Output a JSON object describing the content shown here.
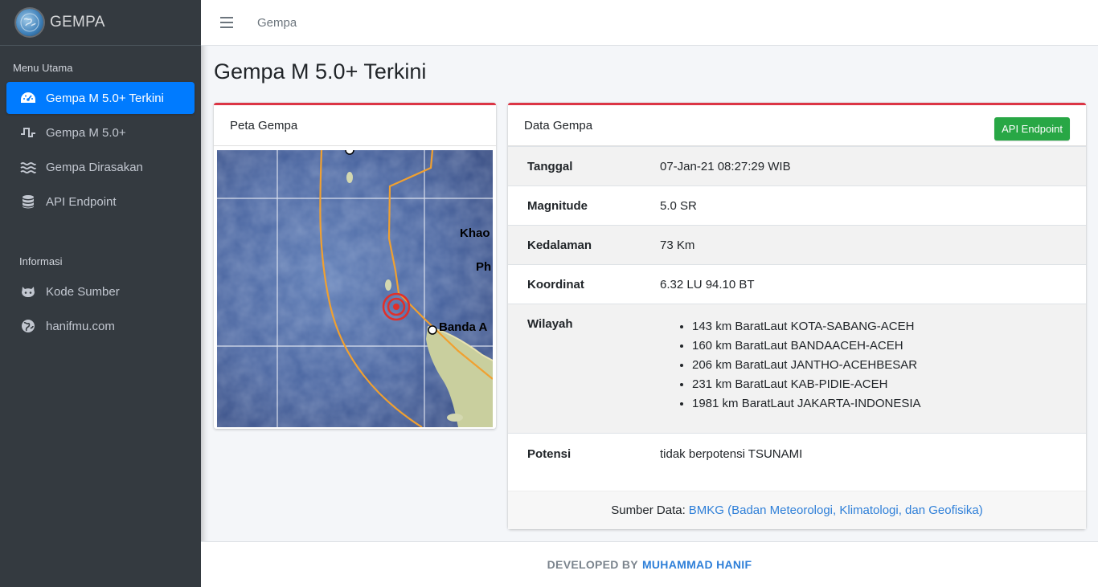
{
  "brand": {
    "name": "GEMPA"
  },
  "sidebar": {
    "header_main": "Menu Utama",
    "items": [
      {
        "label": "Gempa M 5.0+ Terkini",
        "icon": "dashboard-icon",
        "active": true
      },
      {
        "label": "Gempa M 5.0+",
        "icon": "wave-pulse-icon"
      },
      {
        "label": "Gempa Dirasakan",
        "icon": "water-waves-icon"
      },
      {
        "label": "API Endpoint",
        "icon": "database-icon"
      }
    ],
    "header_info": "Informasi",
    "info_items": [
      {
        "label": "Kode Sumber",
        "icon": "github-icon"
      },
      {
        "label": "hanifmu.com",
        "icon": "globe-icon"
      }
    ]
  },
  "topbar": {
    "link": "Gempa"
  },
  "page": {
    "title": "Gempa M 5.0+ Terkini"
  },
  "map_card": {
    "title": "Peta Gempa",
    "labels": {
      "khao": "Khao",
      "ph": "Ph",
      "banda": "Banda A"
    }
  },
  "data_card": {
    "title": "Data Gempa",
    "api_button": "API Endpoint",
    "rows": {
      "tanggal": {
        "label": "Tanggal",
        "value": "07-Jan-21 08:27:29 WIB"
      },
      "magnitude": {
        "label": "Magnitude",
        "value": "5.0 SR"
      },
      "kedalaman": {
        "label": "Kedalaman",
        "value": "73 Km"
      },
      "koordinat": {
        "label": "Koordinat",
        "value": "6.32 LU 94.10 BT"
      },
      "wilayah": {
        "label": "Wilayah",
        "items": [
          "143 km BaratLaut KOTA-SABANG-ACEH",
          "160 km BaratLaut BANDAACEH-ACEH",
          "206 km BaratLaut JANTHO-ACEHBESAR",
          "231 km BaratLaut KAB-PIDIE-ACEH",
          "1981 km BaratLaut JAKARTA-INDONESIA"
        ]
      },
      "potensi": {
        "label": "Potensi",
        "value": "tidak berpotensi TSUNAMI"
      }
    },
    "source_prefix": "Sumber Data:",
    "source_link": "BMKG (Badan Meteorologi, Klimatologi, dan Geofisika)"
  },
  "footer": {
    "prefix": "DEVELOPED BY",
    "author": "MUHAMMAD HANIF"
  },
  "colors": {
    "sidebar": "#343a40",
    "active": "#007bff",
    "card_accent": "#dc3545",
    "button": "#28a745",
    "link": "#2e7fd8"
  }
}
